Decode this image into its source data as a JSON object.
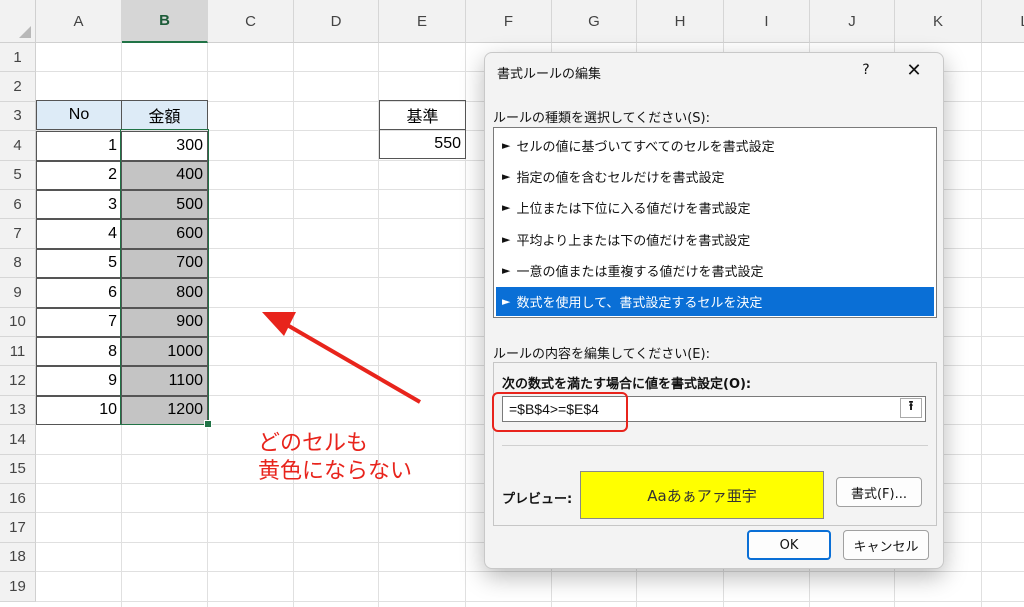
{
  "columns": [
    "A",
    "B",
    "C",
    "D",
    "E",
    "F",
    "G",
    "H",
    "I",
    "J",
    "K",
    "L"
  ],
  "rows": [
    "1",
    "2",
    "3",
    "4",
    "5",
    "6",
    "7",
    "8",
    "9",
    "10",
    "11",
    "12",
    "13",
    "14",
    "15",
    "16",
    "17",
    "18",
    "19"
  ],
  "table": {
    "header_no": "No",
    "header_amount": "金額",
    "no_values": [
      "1",
      "2",
      "3",
      "4",
      "5",
      "6",
      "7",
      "8",
      "9",
      "10"
    ],
    "amount_values": [
      "300",
      "400",
      "500",
      "600",
      "700",
      "800",
      "900",
      "1000",
      "1100",
      "1200"
    ]
  },
  "criterion": {
    "label": "基準",
    "value": "550"
  },
  "annotation": {
    "line1": "どのセルも",
    "line2": "黄色にならない"
  },
  "dialog": {
    "title": "書式ルールの編集",
    "help": "?",
    "close": "✕",
    "select_rule_label": "ルールの種類を選択してください(S):",
    "rule_types": [
      "セルの値に基づいてすべてのセルを書式設定",
      "指定の値を含むセルだけを書式設定",
      "上位または下位に入る値だけを書式設定",
      "平均より上または下の値だけを書式設定",
      "一意の値または重複する値だけを書式設定",
      "数式を使用して、書式設定するセルを決定"
    ],
    "selected_rule_index": 5,
    "edit_rule_label": "ルールの内容を編集してください(E):",
    "formula_label": "次の数式を満たす場合に値を書式設定(O):",
    "formula_value": "=$B$4>=$E$4",
    "preview_label": "プレビュー:",
    "preview_text": "Aaあぁアァ亜宇",
    "preview_color": "#ffff00",
    "format_button": "書式(F)...",
    "ok_button": "OK",
    "cancel_button": "キャンセル"
  },
  "colors": {
    "accent": "#0a6fd6",
    "annotation": "#e8241c",
    "selection": "#217346"
  }
}
